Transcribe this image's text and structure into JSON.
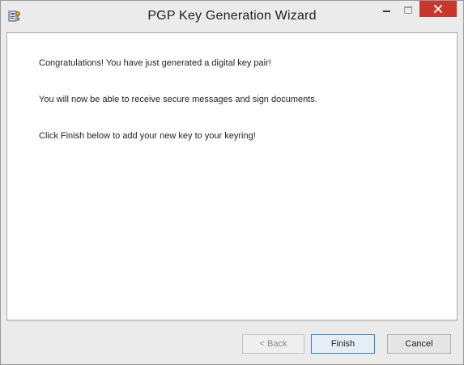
{
  "window": {
    "title": "PGP Key Generation Wizard",
    "app_icon": "pgp-wizard-icon",
    "controls": {
      "minimize": "minimize-icon",
      "maximize": "maximize-icon",
      "close": "close-icon"
    },
    "close_color": "#c7372f"
  },
  "content": {
    "line1": "Congratulations! You have just generated a digital key pair!",
    "line2": "You will now be able to receive secure messages and sign documents.",
    "line3": "Click Finish below to add your new key to your keyring!"
  },
  "footer": {
    "back_label": "< Back",
    "finish_label": "Finish",
    "cancel_label": "Cancel"
  }
}
